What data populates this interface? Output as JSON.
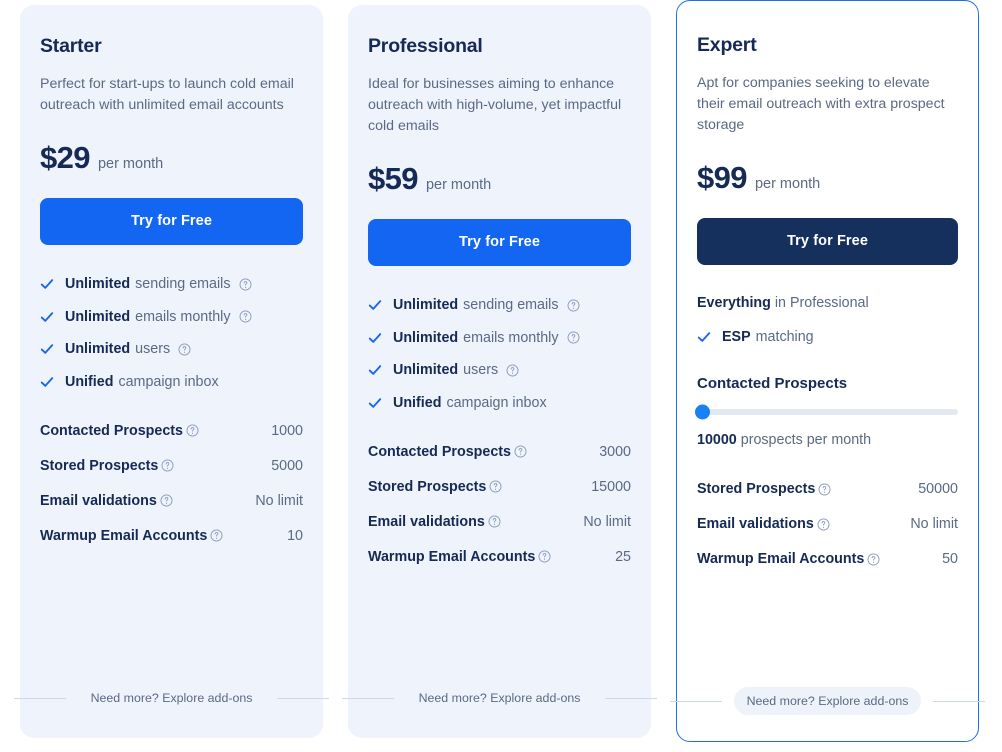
{
  "icons": {
    "check": "check-icon",
    "help": "help-circle-icon"
  },
  "colors": {
    "card_background": "#eff3fc",
    "featured_border": "#1f6fe5",
    "primary_button": "#1366f2",
    "dark_button": "#16305e",
    "heading_text": "#152a54",
    "body_text": "#5a6a84",
    "slider_track": "#e3e9f3",
    "slider_thumb": "#1a81f5"
  },
  "addons": {
    "label": "Need more? Explore add-ons"
  },
  "plans": [
    {
      "name": "Starter",
      "description": "Perfect for start-ups to launch cold email outreach with unlimited email accounts",
      "price": "$29",
      "period": "per month",
      "cta": "Try for Free",
      "features": [
        {
          "strong": "Unlimited",
          "rest": "sending emails",
          "has_help": true
        },
        {
          "strong": "Unlimited",
          "rest": "emails monthly",
          "has_help": true
        },
        {
          "strong": "Unlimited",
          "rest": "users",
          "has_help": true
        },
        {
          "strong": "Unified",
          "rest": "campaign inbox",
          "has_help": false
        }
      ],
      "specs": [
        {
          "label": "Contacted Prospects",
          "value": "1000",
          "has_help": true
        },
        {
          "label": "Stored Prospects",
          "value": "5000",
          "has_help": true
        },
        {
          "label": "Email validations",
          "value": "No limit",
          "has_help": true
        },
        {
          "label": "Warmup Email Accounts",
          "value": "10",
          "has_help": true
        }
      ]
    },
    {
      "name": "Professional",
      "description": "Ideal for businesses aiming to enhance outreach with high-volume, yet impactful cold emails",
      "price": "$59",
      "period": "per month",
      "cta": "Try for Free",
      "features": [
        {
          "strong": "Unlimited",
          "rest": "sending emails",
          "has_help": true
        },
        {
          "strong": "Unlimited",
          "rest": "emails monthly",
          "has_help": true
        },
        {
          "strong": "Unlimited",
          "rest": "users",
          "has_help": true
        },
        {
          "strong": "Unified",
          "rest": "campaign inbox",
          "has_help": false
        }
      ],
      "specs": [
        {
          "label": "Contacted Prospects",
          "value": "3000",
          "has_help": true
        },
        {
          "label": "Stored Prospects",
          "value": "15000",
          "has_help": true
        },
        {
          "label": "Email validations",
          "value": "No limit",
          "has_help": true
        },
        {
          "label": "Warmup Email Accounts",
          "value": "25",
          "has_help": true
        }
      ]
    },
    {
      "name": "Expert",
      "description": "Apt for companies seeking to elevate their email outreach with extra prospect storage",
      "price": "$99",
      "period": "per month",
      "cta": "Try for Free",
      "everything_strong": "Everything",
      "everything_rest": "in Professional",
      "features": [
        {
          "strong": "ESP",
          "rest": "matching",
          "has_help": false
        }
      ],
      "slider": {
        "title": "Contacted Prospects",
        "value_strong": "10000",
        "value_rest": "prospects per month",
        "position_percent": 0
      },
      "specs": [
        {
          "label": "Stored Prospects",
          "value": "50000",
          "has_help": true
        },
        {
          "label": "Email validations",
          "value": "No limit",
          "has_help": true
        },
        {
          "label": "Warmup Email Accounts",
          "value": "50",
          "has_help": true
        }
      ]
    }
  ]
}
